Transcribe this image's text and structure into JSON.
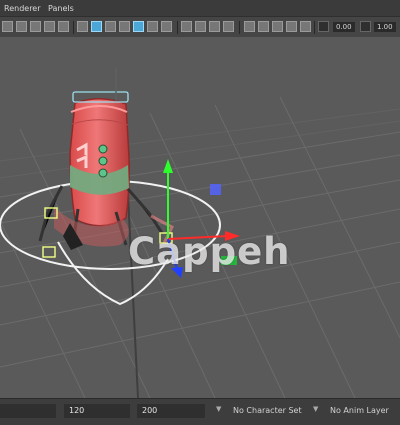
{
  "menu": {
    "items": [
      "Renderer",
      "Panels"
    ]
  },
  "toolbar": {
    "value_a": "0.00",
    "value_b": "1.00"
  },
  "status": {
    "field_a": "",
    "field_b": "120",
    "field_c": "200",
    "character_set": "No Character Set",
    "anim_layer": "No Anim Layer"
  },
  "overlay": {
    "watermark": "Cappeh"
  },
  "colors": {
    "body_red": "#e76060",
    "green_band": "#74aa80",
    "axis_x": "#ff2b2b",
    "axis_y": "#2dff2d",
    "axis_z": "#2140ff"
  }
}
